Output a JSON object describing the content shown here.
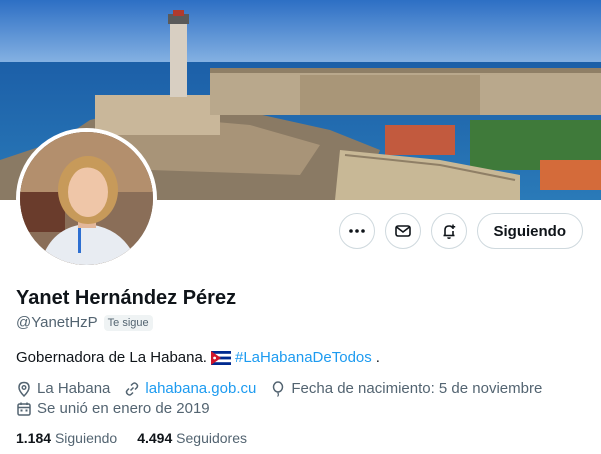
{
  "profile": {
    "name": "Yanet Hernández Pérez",
    "handle": "@YanetHzP",
    "follows_you_badge": "Te sigue",
    "bio_text": "Gobernadora de La Habana.",
    "bio_hashtag": "#LaHabanaDeTodos",
    "bio_end": ".",
    "location": "La Habana",
    "website": "lahabana.gob.cu",
    "birthday": "Fecha de nacimiento: 5 de noviembre",
    "joined": "Se unió en enero de 2019",
    "following_count": "1.184",
    "following_label": "Siguiendo",
    "followers_count": "4.494",
    "followers_label": "Seguidores"
  },
  "actions": {
    "more_icon": "more-icon",
    "message_icon": "envelope-icon",
    "notify_icon": "bell-plus-icon",
    "follow_label": "Siguiendo"
  },
  "colors": {
    "accent": "#1d9bf0",
    "text": "#0f1419",
    "muted": "#536471",
    "border": "#cfd9de"
  }
}
